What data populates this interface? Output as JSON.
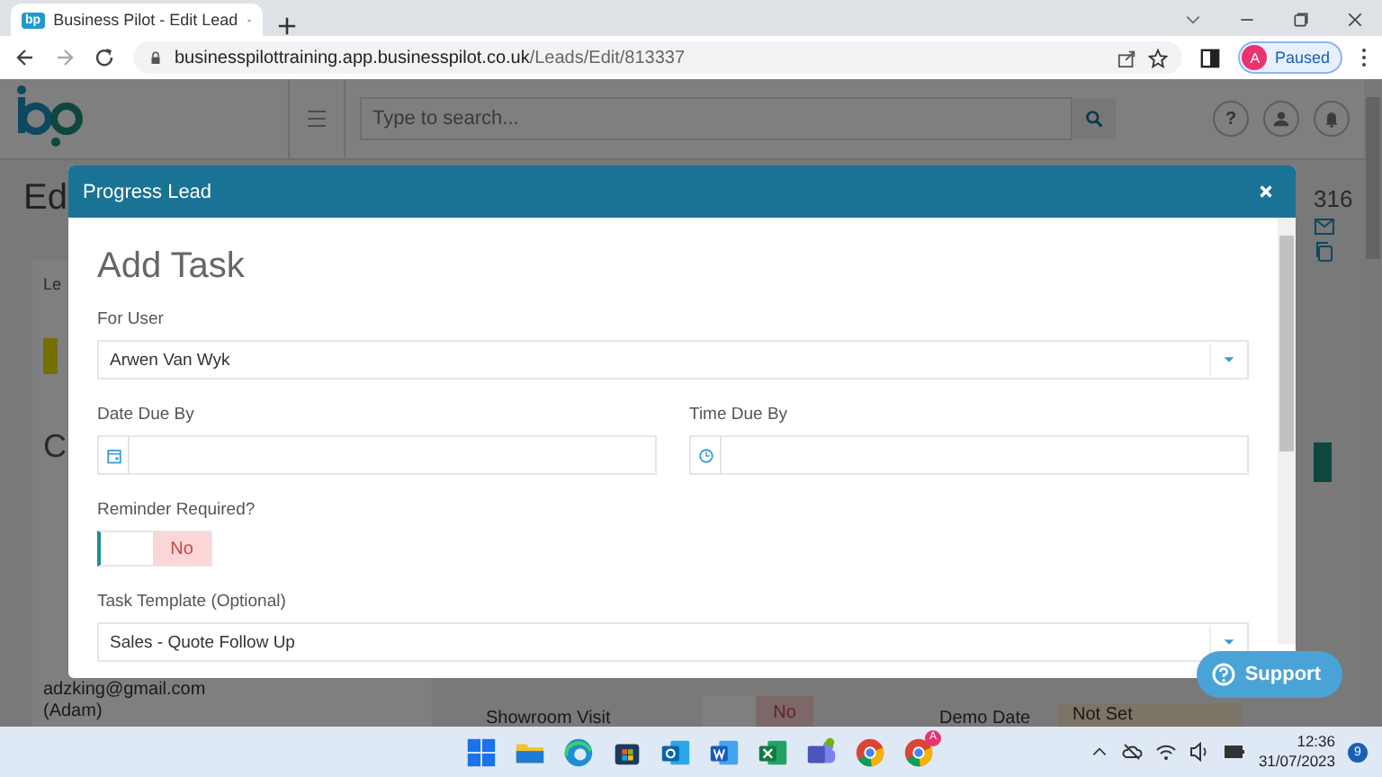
{
  "browser": {
    "tab_title": "Business Pilot - Edit Lead",
    "favicon": "bp",
    "url_host": "businesspilottraining.app.businesspilot.co.uk",
    "url_path": "/Leads/Edit/813337",
    "profile_initial": "A",
    "profile_status": "Paused"
  },
  "app_header": {
    "search_placeholder": "Type to search...",
    "help": "?"
  },
  "page": {
    "title": "Ed",
    "record_number": "316",
    "tab": "Le",
    "section_heading": "C",
    "email": "adzking@gmail.com",
    "contact_name": "(Adam)",
    "showroom_visit": {
      "label": "Showroom Visit",
      "value": "No",
      "on": false
    },
    "demo_date": {
      "label": "Demo Date",
      "value": "Not Set"
    }
  },
  "support_button": "Support",
  "modal": {
    "title": "Progress Lead",
    "heading": "Add Task",
    "for_user": {
      "label": "For User",
      "value": "Arwen Van Wyk"
    },
    "due": [
      {
        "kind": "date",
        "label": "Date Due By"
      },
      {
        "kind": "time",
        "label": "Time Due By"
      }
    ],
    "reminder": {
      "label": "Reminder Required?",
      "on": false,
      "state_label": "No"
    },
    "task_template": {
      "label": "Task Template (Optional)",
      "value": "Sales - Quote Follow Up"
    }
  },
  "taskbar": {
    "chrome_badge": "A",
    "time": "12:36",
    "date": "31/07/2023",
    "notifications": "9"
  }
}
